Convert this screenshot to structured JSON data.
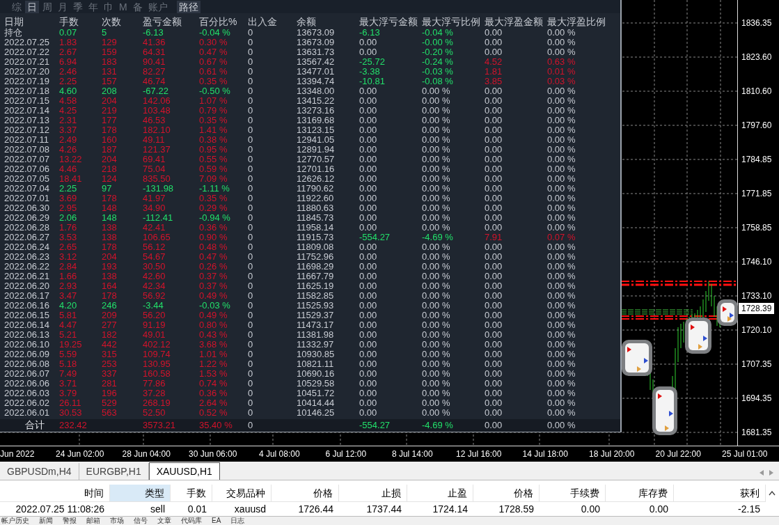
{
  "stats_panel": {
    "tabs": [
      {
        "label": "综",
        "selected": false
      },
      {
        "label": "日",
        "selected": true
      },
      {
        "label": "周",
        "selected": false
      },
      {
        "label": "月",
        "selected": false
      },
      {
        "label": "季",
        "selected": false
      },
      {
        "label": "年",
        "selected": false
      },
      {
        "label": "巾",
        "selected": false
      },
      {
        "label": "M",
        "selected": false
      },
      {
        "label": "备",
        "selected": false
      },
      {
        "label": "账户",
        "selected": false
      }
    ],
    "path_button": "路径",
    "columns": [
      "日期",
      "手数",
      "次数",
      "盈亏金额",
      "百分比%",
      "出入金",
      "余额",
      "最大浮亏金额",
      "最大浮亏比例",
      "最大浮盈金额",
      "最大浮盈比例"
    ],
    "rows": [
      {
        "cells": [
          "持仓",
          "0.07",
          "5",
          "-6.13",
          "-0.04 %",
          "0",
          "13673.09",
          "-6.13",
          "-0.04 %",
          "0.00",
          "0.00 %"
        ],
        "in_profit": false,
        "loss_amount_hit": true,
        "loss_pct_hit": true,
        "profit_hit": false
      },
      {
        "cells": [
          "2022.07.25",
          "1.83",
          "129",
          "41.36",
          "0.30 %",
          "0",
          "13673.09",
          "0.00",
          "-0.00 %",
          "0.00",
          "0.00 %"
        ],
        "in_profit": true,
        "loss_amount_hit": false,
        "loss_pct_hit": true,
        "profit_hit": false
      },
      {
        "cells": [
          "2022.07.22",
          "2.67",
          "159",
          "64.31",
          "0.47 %",
          "0",
          "13631.73",
          "0.00",
          "-0.20 %",
          "0.00",
          "0.00 %"
        ],
        "in_profit": true,
        "loss_amount_hit": false,
        "loss_pct_hit": true,
        "profit_hit": false
      },
      {
        "cells": [
          "2022.07.21",
          "6.94",
          "183",
          "90.41",
          "0.67 %",
          "0",
          "13567.42",
          "-25.72",
          "-0.24 %",
          "4.52",
          "0.63 %"
        ],
        "in_profit": true,
        "loss_amount_hit": true,
        "loss_pct_hit": true,
        "profit_hit": true
      },
      {
        "cells": [
          "2022.07.20",
          "2.46",
          "131",
          "82.27",
          "0.61 %",
          "0",
          "13477.01",
          "-3.38",
          "-0.03 %",
          "1.81",
          "0.01 %"
        ],
        "in_profit": true,
        "loss_amount_hit": true,
        "loss_pct_hit": true,
        "profit_hit": true
      },
      {
        "cells": [
          "2022.07.19",
          "2.25",
          "157",
          "46.74",
          "0.35 %",
          "0",
          "13394.74",
          "-10.81",
          "-0.08 %",
          "3.85",
          "0.03 %"
        ],
        "in_profit": true,
        "loss_amount_hit": true,
        "loss_pct_hit": true,
        "profit_hit": true
      },
      {
        "cells": [
          "2022.07.18",
          "4.60",
          "208",
          "-67.22",
          "-0.50 %",
          "0",
          "13348.00",
          "0.00",
          "0.00 %",
          "0.00",
          "0.00 %"
        ],
        "in_profit": false,
        "loss_amount_hit": false,
        "loss_pct_hit": false,
        "profit_hit": false
      },
      {
        "cells": [
          "2022.07.15",
          "4.58",
          "204",
          "142.06",
          "1.07 %",
          "0",
          "13415.22",
          "0.00",
          "0.00 %",
          "0.00",
          "0.00 %"
        ],
        "in_profit": true,
        "loss_amount_hit": false,
        "loss_pct_hit": false,
        "profit_hit": false
      },
      {
        "cells": [
          "2022.07.14",
          "4.25",
          "219",
          "103.48",
          "0.79 %",
          "0",
          "13273.16",
          "0.00",
          "0.00 %",
          "0.00",
          "0.00 %"
        ],
        "in_profit": true,
        "loss_amount_hit": false,
        "loss_pct_hit": false,
        "profit_hit": false
      },
      {
        "cells": [
          "2022.07.13",
          "2.31",
          "177",
          "46.53",
          "0.35 %",
          "0",
          "13169.68",
          "0.00",
          "0.00 %",
          "0.00",
          "0.00 %"
        ],
        "in_profit": true,
        "loss_amount_hit": false,
        "loss_pct_hit": false,
        "profit_hit": false
      },
      {
        "cells": [
          "2022.07.12",
          "3.37",
          "178",
          "182.10",
          "1.41 %",
          "0",
          "13123.15",
          "0.00",
          "0.00 %",
          "0.00",
          "0.00 %"
        ],
        "in_profit": true,
        "loss_amount_hit": false,
        "loss_pct_hit": false,
        "profit_hit": false
      },
      {
        "cells": [
          "2022.07.11",
          "2.49",
          "160",
          "49.11",
          "0.38 %",
          "0",
          "12941.05",
          "0.00",
          "0.00 %",
          "0.00",
          "0.00 %"
        ],
        "in_profit": true,
        "loss_amount_hit": false,
        "loss_pct_hit": false,
        "profit_hit": false
      },
      {
        "cells": [
          "2022.07.08",
          "4.26",
          "187",
          "121.37",
          "0.95 %",
          "0",
          "12891.94",
          "0.00",
          "0.00 %",
          "0.00",
          "0.00 %"
        ],
        "in_profit": true,
        "loss_amount_hit": false,
        "loss_pct_hit": false,
        "profit_hit": false
      },
      {
        "cells": [
          "2022.07.07",
          "13.22",
          "204",
          "69.41",
          "0.55 %",
          "0",
          "12770.57",
          "0.00",
          "0.00 %",
          "0.00",
          "0.00 %"
        ],
        "in_profit": true,
        "loss_amount_hit": false,
        "loss_pct_hit": false,
        "profit_hit": false
      },
      {
        "cells": [
          "2022.07.06",
          "4.46",
          "218",
          "75.04",
          "0.59 %",
          "0",
          "12701.16",
          "0.00",
          "0.00 %",
          "0.00",
          "0.00 %"
        ],
        "in_profit": true,
        "loss_amount_hit": false,
        "loss_pct_hit": false,
        "profit_hit": false
      },
      {
        "cells": [
          "2022.07.05",
          "18.41",
          "124",
          "835.50",
          "7.09 %",
          "0",
          "12626.12",
          "0.00",
          "0.00 %",
          "0.00",
          "0.00 %"
        ],
        "in_profit": true,
        "loss_amount_hit": false,
        "loss_pct_hit": false,
        "profit_hit": false
      },
      {
        "cells": [
          "2022.07.04",
          "2.25",
          "97",
          "-131.98",
          "-1.11 %",
          "0",
          "11790.62",
          "0.00",
          "0.00 %",
          "0.00",
          "0.00 %"
        ],
        "in_profit": false,
        "loss_amount_hit": false,
        "loss_pct_hit": false,
        "profit_hit": false
      },
      {
        "cells": [
          "2022.07.01",
          "3.69",
          "178",
          "41.97",
          "0.35 %",
          "0",
          "11922.60",
          "0.00",
          "0.00 %",
          "0.00",
          "0.00 %"
        ],
        "in_profit": true,
        "loss_amount_hit": false,
        "loss_pct_hit": false,
        "profit_hit": false
      },
      {
        "cells": [
          "2022.06.30",
          "2.95",
          "148",
          "34.90",
          "0.29 %",
          "0",
          "11880.63",
          "0.00",
          "0.00 %",
          "0.00",
          "0.00 %"
        ],
        "in_profit": true,
        "loss_amount_hit": false,
        "loss_pct_hit": false,
        "profit_hit": false
      },
      {
        "cells": [
          "2022.06.29",
          "2.06",
          "148",
          "-112.41",
          "-0.94 %",
          "0",
          "11845.73",
          "0.00",
          "0.00 %",
          "0.00",
          "0.00 %"
        ],
        "in_profit": false,
        "loss_amount_hit": false,
        "loss_pct_hit": false,
        "profit_hit": false
      },
      {
        "cells": [
          "2022.06.28",
          "1.76",
          "138",
          "42.41",
          "0.36 %",
          "0",
          "11958.14",
          "0.00",
          "0.00 %",
          "0.00",
          "0.00 %"
        ],
        "in_profit": true,
        "loss_amount_hit": false,
        "loss_pct_hit": false,
        "profit_hit": false
      },
      {
        "cells": [
          "2022.06.27",
          "3.53",
          "138",
          "106.65",
          "0.90 %",
          "0",
          "11915.73",
          "-554.27",
          "-4.69 %",
          "7.91",
          "0.07 %"
        ],
        "in_profit": true,
        "loss_amount_hit": true,
        "loss_pct_hit": true,
        "profit_hit": true
      },
      {
        "cells": [
          "2022.06.24",
          "2.65",
          "178",
          "56.12",
          "0.48 %",
          "0",
          "11809.08",
          "0.00",
          "0.00 %",
          "0.00",
          "0.00 %"
        ],
        "in_profit": true,
        "loss_amount_hit": false,
        "loss_pct_hit": false,
        "profit_hit": false
      },
      {
        "cells": [
          "2022.06.23",
          "3.12",
          "204",
          "54.67",
          "0.47 %",
          "0",
          "11752.96",
          "0.00",
          "0.00 %",
          "0.00",
          "0.00 %"
        ],
        "in_profit": true,
        "loss_amount_hit": false,
        "loss_pct_hit": false,
        "profit_hit": false
      },
      {
        "cells": [
          "2022.06.22",
          "2.84",
          "193",
          "30.50",
          "0.26 %",
          "0",
          "11698.29",
          "0.00",
          "0.00 %",
          "0.00",
          "0.00 %"
        ],
        "in_profit": true,
        "loss_amount_hit": false,
        "loss_pct_hit": false,
        "profit_hit": false
      },
      {
        "cells": [
          "2022.06.21",
          "1.66",
          "138",
          "42.60",
          "0.37 %",
          "0",
          "11667.79",
          "0.00",
          "0.00 %",
          "0.00",
          "0.00 %"
        ],
        "in_profit": true,
        "loss_amount_hit": false,
        "loss_pct_hit": false,
        "profit_hit": false
      },
      {
        "cells": [
          "2022.06.20",
          "2.93",
          "164",
          "42.34",
          "0.37 %",
          "0",
          "11625.19",
          "0.00",
          "0.00 %",
          "0.00",
          "0.00 %"
        ],
        "in_profit": true,
        "loss_amount_hit": false,
        "loss_pct_hit": false,
        "profit_hit": false
      },
      {
        "cells": [
          "2022.06.17",
          "3.47",
          "178",
          "56.92",
          "0.49 %",
          "0",
          "11582.85",
          "0.00",
          "0.00 %",
          "0.00",
          "0.00 %"
        ],
        "in_profit": true,
        "loss_amount_hit": false,
        "loss_pct_hit": false,
        "profit_hit": false
      },
      {
        "cells": [
          "2022.06.16",
          "4.20",
          "246",
          "-3.44",
          "-0.03 %",
          "0",
          "11525.93",
          "0.00",
          "0.00 %",
          "0.00",
          "0.00 %"
        ],
        "in_profit": false,
        "loss_amount_hit": false,
        "loss_pct_hit": false,
        "profit_hit": false
      },
      {
        "cells": [
          "2022.06.15",
          "5.81",
          "209",
          "56.20",
          "0.49 %",
          "0",
          "11529.37",
          "0.00",
          "0.00 %",
          "0.00",
          "0.00 %"
        ],
        "in_profit": true,
        "loss_amount_hit": false,
        "loss_pct_hit": false,
        "profit_hit": false
      },
      {
        "cells": [
          "2022.06.14",
          "4.47",
          "277",
          "91.19",
          "0.80 %",
          "0",
          "11473.17",
          "0.00",
          "0.00 %",
          "0.00",
          "0.00 %"
        ],
        "in_profit": true,
        "loss_amount_hit": false,
        "loss_pct_hit": false,
        "profit_hit": false
      },
      {
        "cells": [
          "2022.06.13",
          "5.21",
          "182",
          "49.01",
          "0.43 %",
          "0",
          "11381.98",
          "0.00",
          "0.00 %",
          "0.00",
          "0.00 %"
        ],
        "in_profit": true,
        "loss_amount_hit": false,
        "loss_pct_hit": false,
        "profit_hit": false
      },
      {
        "cells": [
          "2022.06.10",
          "19.25",
          "442",
          "402.12",
          "3.68 %",
          "0",
          "11332.97",
          "0.00",
          "0.00 %",
          "0.00",
          "0.00 %"
        ],
        "in_profit": true,
        "loss_amount_hit": false,
        "loss_pct_hit": false,
        "profit_hit": false
      },
      {
        "cells": [
          "2022.06.09",
          "5.59",
          "315",
          "109.74",
          "1.01 %",
          "0",
          "10930.85",
          "0.00",
          "0.00 %",
          "0.00",
          "0.00 %"
        ],
        "in_profit": true,
        "loss_amount_hit": false,
        "loss_pct_hit": false,
        "profit_hit": false
      },
      {
        "cells": [
          "2022.06.08",
          "5.18",
          "253",
          "130.95",
          "1.22 %",
          "0",
          "10821.11",
          "0.00",
          "0.00 %",
          "0.00",
          "0.00 %"
        ],
        "in_profit": true,
        "loss_amount_hit": false,
        "loss_pct_hit": false,
        "profit_hit": false
      },
      {
        "cells": [
          "2022.06.07",
          "7.49",
          "337",
          "160.58",
          "1.53 %",
          "0",
          "10690.16",
          "0.00",
          "0.00 %",
          "0.00",
          "0.00 %"
        ],
        "in_profit": true,
        "loss_amount_hit": false,
        "loss_pct_hit": false,
        "profit_hit": false
      },
      {
        "cells": [
          "2022.06.06",
          "3.71",
          "281",
          "77.86",
          "0.74 %",
          "0",
          "10529.58",
          "0.00",
          "0.00 %",
          "0.00",
          "0.00 %"
        ],
        "in_profit": true,
        "loss_amount_hit": false,
        "loss_pct_hit": false,
        "profit_hit": false
      },
      {
        "cells": [
          "2022.06.03",
          "3.79",
          "196",
          "37.28",
          "0.36 %",
          "0",
          "10451.72",
          "0.00",
          "0.00 %",
          "0.00",
          "0.00 %"
        ],
        "in_profit": true,
        "loss_amount_hit": false,
        "loss_pct_hit": false,
        "profit_hit": false
      },
      {
        "cells": [
          "2022.06.02",
          "26.11",
          "529",
          "268.19",
          "2.64 %",
          "0",
          "10414.44",
          "0.00",
          "0.00 %",
          "0.00",
          "0.00 %"
        ],
        "in_profit": true,
        "loss_amount_hit": false,
        "loss_pct_hit": false,
        "profit_hit": false
      },
      {
        "cells": [
          "2022.06.01",
          "30.53",
          "563",
          "52.50",
          "0.52 %",
          "0",
          "10146.25",
          "0.00",
          "0.00 %",
          "0.00",
          "0.00 %"
        ],
        "in_profit": true,
        "loss_amount_hit": false,
        "loss_pct_hit": false,
        "profit_hit": false
      }
    ],
    "total": {
      "label": "合计",
      "lots": "232.42",
      "pnl": "3573.21",
      "pct": "35.40 %",
      "inout": "0",
      "loss_amount": "-554.27",
      "loss_pct": "-4.69 %",
      "profit_amount": "0.00",
      "profit_pct": "0.00 %",
      "in_profit": true,
      "loss_amount_hit": true,
      "loss_pct_hit": true,
      "profit_hit": false
    }
  },
  "chart": {
    "price_ticks": [
      "1836.35",
      "1823.60",
      "1810.60",
      "1797.60",
      "1784.85",
      "1771.85",
      "1758.85",
      "1746.10",
      "1733.10",
      "1720.10",
      "1707.35",
      "1694.35",
      "1681.35"
    ],
    "current_price": "1728.39",
    "time_ticks": [
      "Jun 2022",
      "24 Jun 02:00",
      "28 Jun 04:00",
      "30 Jun 06:00",
      "4 Jul 08:00",
      "6 Jul 12:00",
      "8 Jul 14:00",
      "12 Jul 16:00",
      "14 Jul 18:00",
      "18 Jul 20:00",
      "20 Jul 22:00",
      "25 Jul 01:00"
    ]
  },
  "symbol_tabs": [
    {
      "label": "GBPUSDm,H4",
      "selected": false
    },
    {
      "label": "EURGBP,H1",
      "selected": false
    },
    {
      "label": "XAUUSD,H1",
      "selected": true
    }
  ],
  "trades": {
    "columns": [
      {
        "label": "时间",
        "sorted": false
      },
      {
        "label": "类型",
        "sorted": true
      },
      {
        "label": "手数",
        "sorted": false
      },
      {
        "label": "交易品种",
        "sorted": false
      },
      {
        "label": "价格",
        "sorted": false
      },
      {
        "label": "止损",
        "sorted": false
      },
      {
        "label": "止盈",
        "sorted": false
      },
      {
        "label": "价格",
        "sorted": false
      },
      {
        "label": "手续费",
        "sorted": false
      },
      {
        "label": "库存费",
        "sorted": false
      },
      {
        "label": "获利",
        "sorted": false
      }
    ],
    "rows": [
      {
        "cells": [
          "2022.07.25 11:08:26",
          "sell",
          "0.01",
          "xauusd",
          "1726.44",
          "1737.44",
          "1724.14",
          "1728.59",
          "0.00",
          "0.00",
          "-2.15"
        ]
      }
    ]
  },
  "bottom_tabs": [
    "帐户历史",
    "新闻",
    "警报",
    "邮箱",
    "市场",
    "信号",
    "文章",
    "代码库",
    "EA",
    "日志"
  ]
}
